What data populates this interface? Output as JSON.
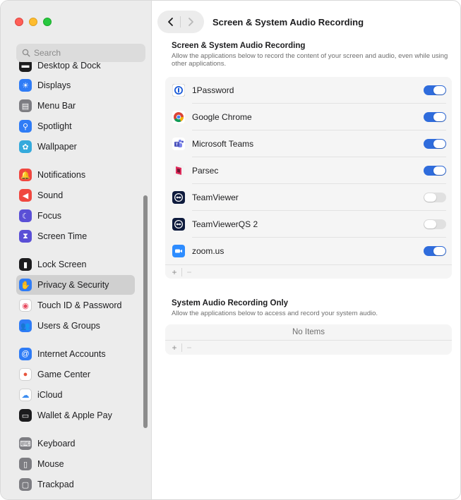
{
  "window": {
    "title": "Screen & System Audio Recording"
  },
  "sidebar": {
    "search_placeholder": "Search",
    "items": [
      {
        "label": "Desktop & Dock",
        "icon": "dock-icon",
        "color": "#1c1c1e"
      },
      {
        "label": "Displays",
        "icon": "sun-icon",
        "color": "#2f7cf6"
      },
      {
        "label": "Menu Bar",
        "icon": "menubar-icon",
        "color": "#7d7d82"
      },
      {
        "label": "Spotlight",
        "icon": "magnifier-icon",
        "color": "#2f7cf6"
      },
      {
        "label": "Wallpaper",
        "icon": "flower-icon",
        "color": "#35aadc"
      },
      {
        "label": "Notifications",
        "icon": "bell-icon",
        "color": "#f0473f"
      },
      {
        "label": "Sound",
        "icon": "speaker-icon",
        "color": "#f0473f"
      },
      {
        "label": "Focus",
        "icon": "moon-icon",
        "color": "#5a4fd6"
      },
      {
        "label": "Screen Time",
        "icon": "hourglass-icon",
        "color": "#5a4fd6"
      },
      {
        "label": "Lock Screen",
        "icon": "lock-icon",
        "color": "#1c1c1e"
      },
      {
        "label": "Privacy & Security",
        "icon": "hand-icon",
        "color": "#2f7cf6"
      },
      {
        "label": "Touch ID & Password",
        "icon": "fingerprint-icon",
        "color": "#ffffff"
      },
      {
        "label": "Users & Groups",
        "icon": "users-icon",
        "color": "#2f7cf6"
      },
      {
        "label": "Internet Accounts",
        "icon": "at-icon",
        "color": "#2f7cf6"
      },
      {
        "label": "Game Center",
        "icon": "gamecenter-icon",
        "color": "#ffffff"
      },
      {
        "label": "iCloud",
        "icon": "cloud-icon",
        "color": "#ffffff"
      },
      {
        "label": "Wallet & Apple Pay",
        "icon": "wallet-icon",
        "color": "#1c1c1e"
      },
      {
        "label": "Keyboard",
        "icon": "keyboard-icon",
        "color": "#7d7d82"
      },
      {
        "label": "Mouse",
        "icon": "mouse-icon",
        "color": "#7d7d82"
      },
      {
        "label": "Trackpad",
        "icon": "trackpad-icon",
        "color": "#7d7d82"
      }
    ],
    "selected": "Privacy & Security"
  },
  "main": {
    "section1": {
      "title": "Screen & System Audio Recording",
      "description": "Allow the applications below to record the content of your screen and audio, even while using other applications.",
      "apps": [
        {
          "name": "1Password",
          "icon": "1password-icon",
          "enabled": true
        },
        {
          "name": "Google Chrome",
          "icon": "chrome-icon",
          "enabled": true
        },
        {
          "name": "Microsoft Teams",
          "icon": "teams-icon",
          "enabled": true
        },
        {
          "name": "Parsec",
          "icon": "parsec-icon",
          "enabled": true
        },
        {
          "name": "TeamViewer",
          "icon": "teamviewer-icon",
          "enabled": false
        },
        {
          "name": "TeamViewerQS 2",
          "icon": "teamviewerqs-icon",
          "enabled": false
        },
        {
          "name": "zoom.us",
          "icon": "zoom-icon",
          "enabled": true
        }
      ],
      "add_label": "+",
      "remove_label": "−"
    },
    "section2": {
      "title": "System Audio Recording Only",
      "description": "Allow the applications below to access and record your system audio.",
      "empty_text": "No Items",
      "add_label": "+",
      "remove_label": "−"
    }
  },
  "colors": {
    "accent": "#2f6cdc",
    "sidebar_bg": "#ececec",
    "selected_bg": "#d0d0d0"
  }
}
